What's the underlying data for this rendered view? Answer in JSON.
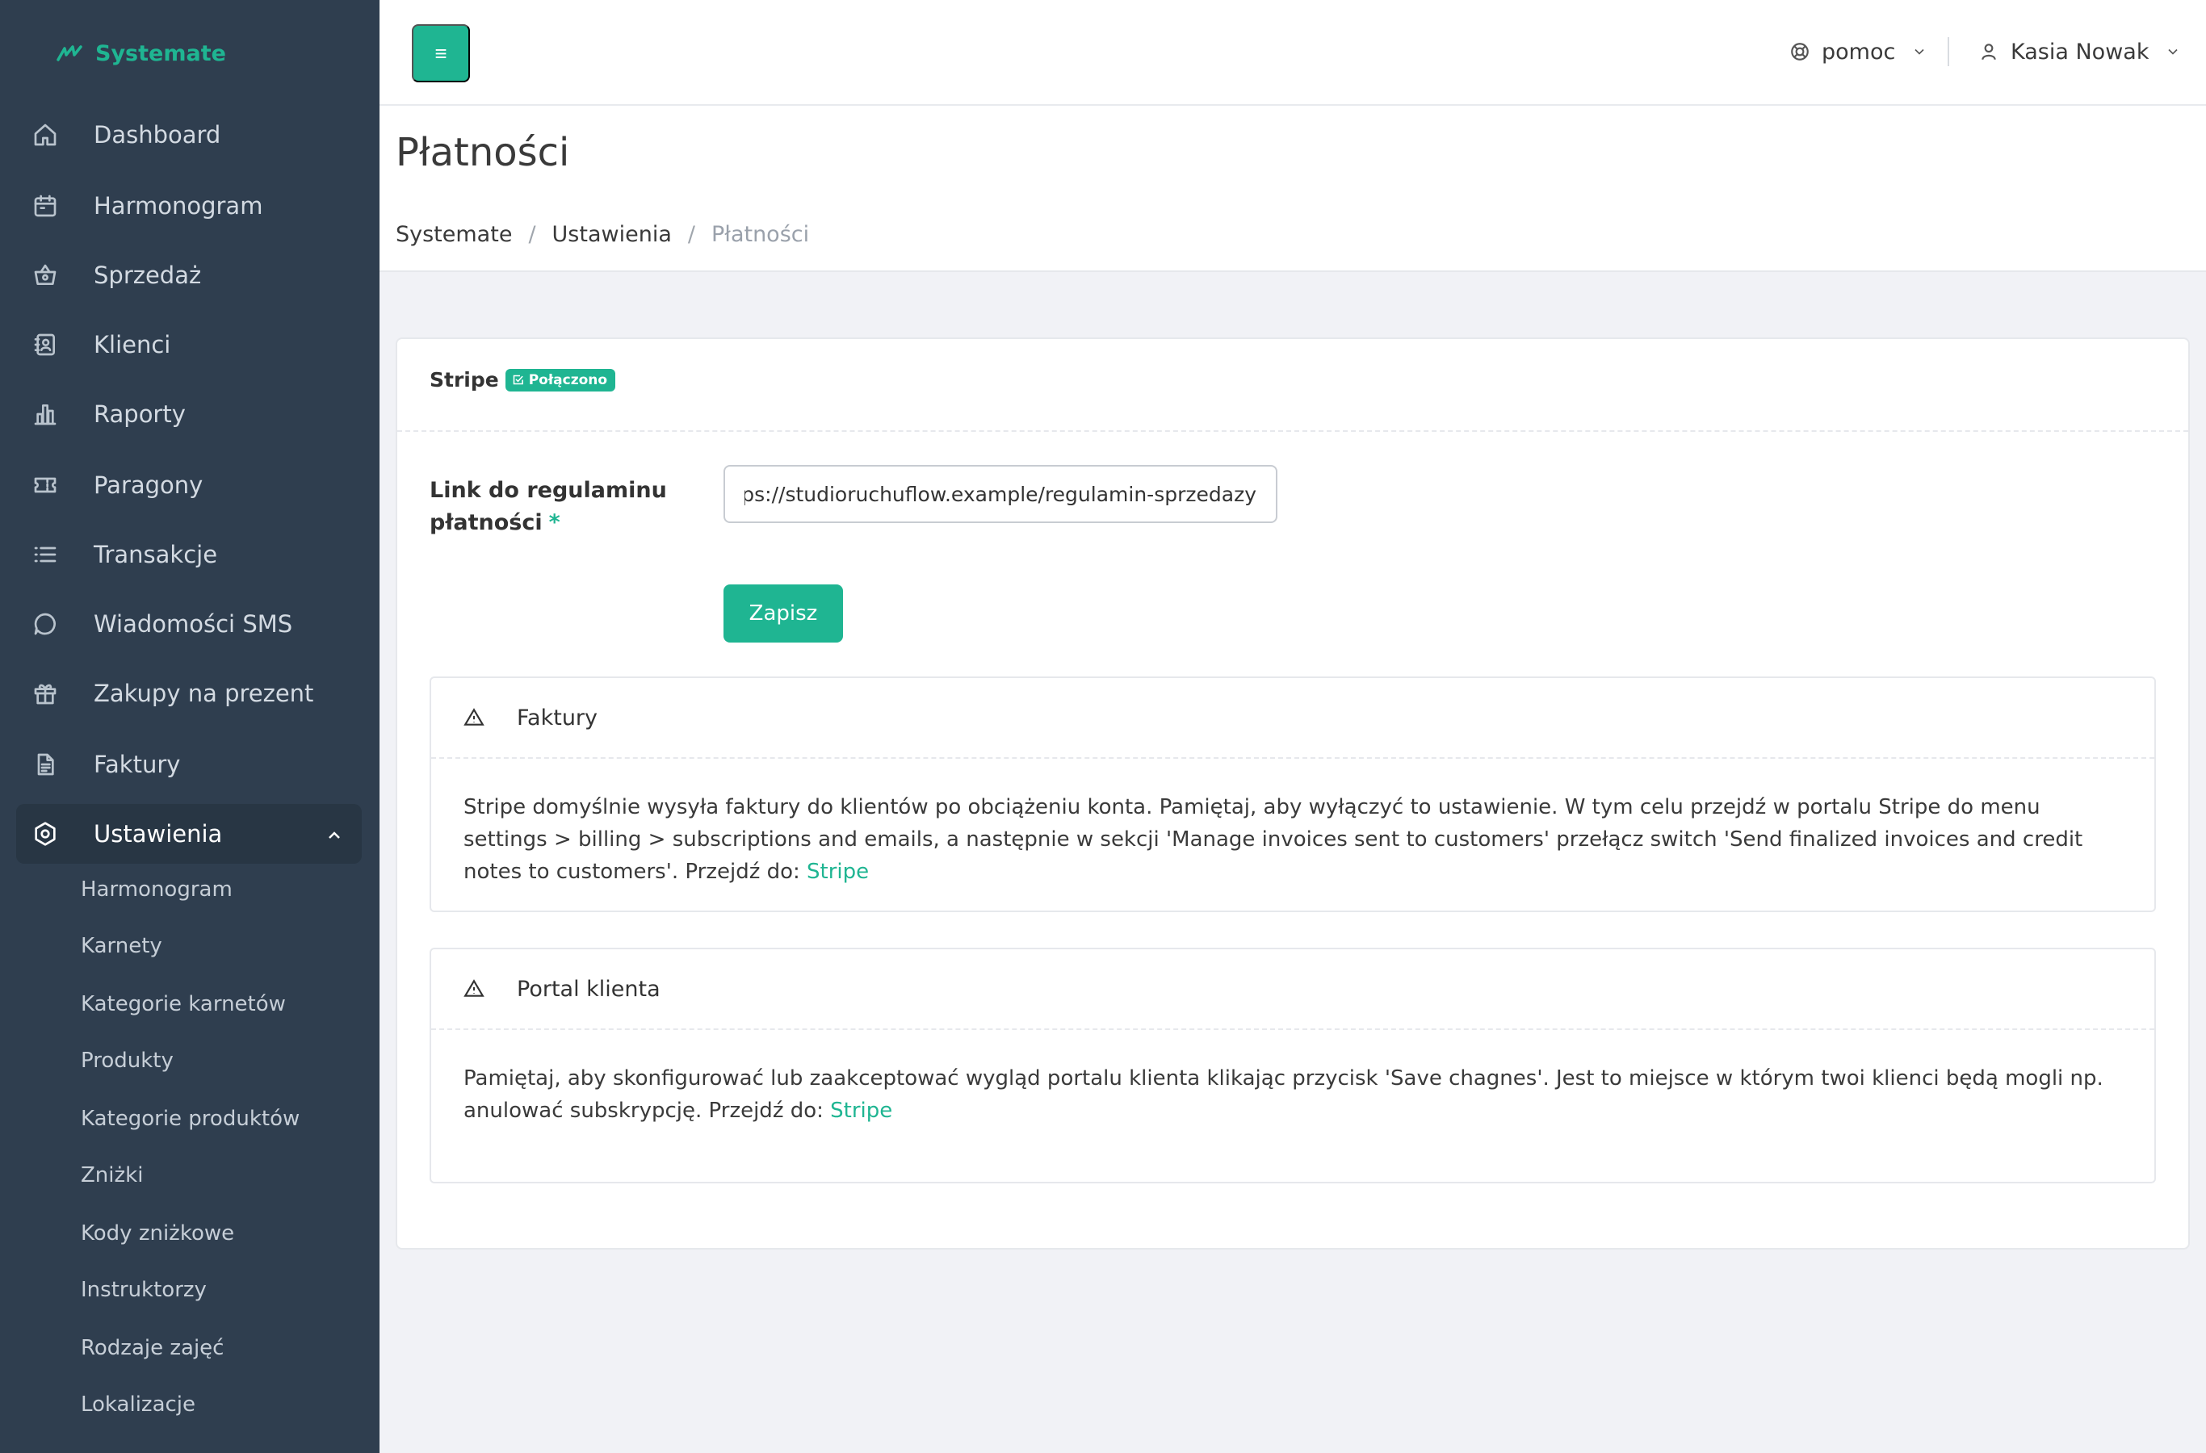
{
  "brand": {
    "name": "Systemate"
  },
  "sidebar": {
    "items": [
      {
        "label": "Dashboard",
        "icon": "home-icon"
      },
      {
        "label": "Harmonogram",
        "icon": "calendar-icon"
      },
      {
        "label": "Sprzedaż",
        "icon": "basket-icon"
      },
      {
        "label": "Klienci",
        "icon": "contacts-icon"
      },
      {
        "label": "Raporty",
        "icon": "bar-chart-icon"
      },
      {
        "label": "Paragony",
        "icon": "ticket-icon"
      },
      {
        "label": "Transakcje",
        "icon": "list-icon"
      },
      {
        "label": "Wiadomości SMS",
        "icon": "chat-icon"
      },
      {
        "label": "Zakupy na prezent",
        "icon": "gift-icon"
      },
      {
        "label": "Faktury",
        "icon": "document-icon"
      },
      {
        "label": "Ustawienia",
        "icon": "settings-icon",
        "active": true
      }
    ],
    "subitems": [
      "Harmonogram",
      "Karnety",
      "Kategorie karnetów",
      "Produkty",
      "Kategorie produktów",
      "Zniżki",
      "Kody zniżkowe",
      "Instruktorzy",
      "Rodzaje zajęć",
      "Lokalizacje"
    ]
  },
  "topbar": {
    "menu_icon": "≡",
    "help_label": "pomoc",
    "user_name": "Kasia Nowak"
  },
  "page": {
    "title": "Płatności",
    "breadcrumb": [
      "Systemate",
      "Ustawienia",
      "Płatności"
    ],
    "breadcrumb_sep": "/"
  },
  "card": {
    "provider": "Stripe",
    "badge": "Połączono",
    "field_label_line1": "Link do regulaminu",
    "field_label_line2": "płatności",
    "required_mark": "*",
    "field_value": "https://studioruchuflow.example/regulamin-sprzedazy",
    "save_label": "Zapisz",
    "panels": [
      {
        "title": "Faktury",
        "text": "Stripe domyślnie wysyła faktury do klientów po obciążeniu konta. Pamiętaj, aby wyłączyć to ustawienie. W tym celu przejdź w portalu Stripe do menu settings > billing > subscriptions and emails, a następnie w sekcji 'Manage invoices sent to customers' przełącz switch 'Send finalized invoices and credit notes to customers'. Przejdź do: ",
        "link": "Stripe"
      },
      {
        "title": "Portal klienta",
        "text": "Pamiętaj, aby skonfigurować lub zaakceptować wygląd portalu klienta klikając przycisk 'Save chagnes'. Jest to miejsce w którym twoi klienci będą mogli np. anulować subskrypcję. Przejdź do: ",
        "link": "Stripe"
      }
    ]
  },
  "colors": {
    "accent": "#1fb592",
    "sidebar_bg": "#2f3e4f",
    "page_bg": "#f1f2f6"
  }
}
